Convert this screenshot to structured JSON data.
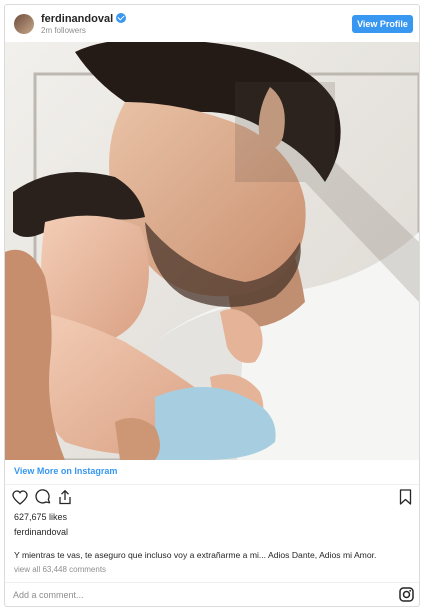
{
  "header": {
    "username": "ferdinandoval",
    "followers": "2m followers",
    "view_profile_label": "View Profile"
  },
  "post": {
    "view_more_label": "View More on Instagram",
    "likes": "627,675 likes",
    "owner": "ferdinandoval",
    "caption": "Y mientras te vas, te aseguro que incluso voy a extrañarme a mi... Adios Dante, Adios mi Amor.",
    "comments_link": "view all 63,448 comments",
    "comment_placeholder": "Add a comment..."
  },
  "icons": [
    "verified-badge-icon",
    "heart-icon",
    "comment-icon",
    "share-icon",
    "bookmark-icon",
    "instagram-logo-icon"
  ],
  "colors": {
    "accent": "#3897f0",
    "text": "#262626",
    "muted": "#8e8e8e",
    "border": "#dbdbdb"
  }
}
